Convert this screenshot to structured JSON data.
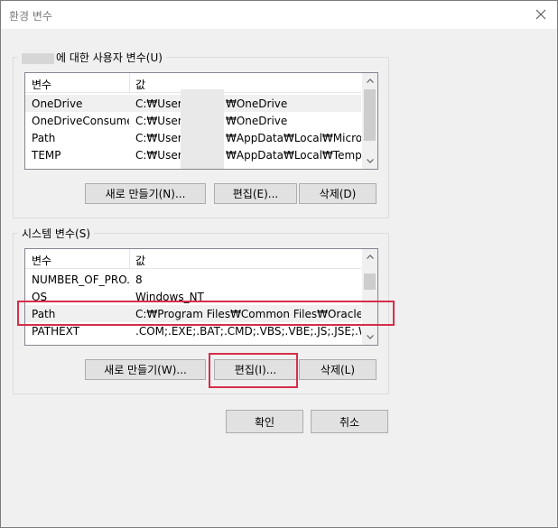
{
  "window": {
    "title": "환경 변수"
  },
  "user_vars": {
    "group_label": "에 대한 사용자 변수(U)",
    "col_name": "변수",
    "col_value": "값",
    "rows": [
      {
        "name": "OneDrive",
        "value_prefix": "C:₩Users",
        "value_suffix": "₩OneDrive"
      },
      {
        "name": "OneDriveConsumer",
        "value_prefix": "C:₩Users",
        "value_suffix": "₩OneDrive"
      },
      {
        "name": "Path",
        "value_prefix": "C:₩Users",
        "value_suffix": "₩AppData₩Local₩Micros..."
      },
      {
        "name": "TEMP",
        "value_prefix": "C:₩Users",
        "value_suffix": "₩AppData₩Local₩Temp"
      }
    ],
    "btn_new": "새로 만들기(N)...",
    "btn_edit": "편집(E)...",
    "btn_delete": "삭제(D)"
  },
  "system_vars": {
    "group_label": "시스템 변수(S)",
    "col_name": "변수",
    "col_value": "값",
    "rows": [
      {
        "name": "NUMBER_OF_PRO...",
        "value": "8"
      },
      {
        "name": "OS",
        "value": "Windows_NT"
      },
      {
        "name": "Path",
        "value": "C:₩Program Files₩Common Files₩Oracle₩..."
      },
      {
        "name": "PATHEXT",
        "value": ".COM;.EXE;.BAT;.CMD;.VBS;.VBE;.JS;.JSE;.W..."
      }
    ],
    "btn_new": "새로 만들기(W)...",
    "btn_edit": "편집(I)...",
    "btn_delete": "삭제(L)"
  },
  "footer": {
    "btn_ok": "확인",
    "btn_cancel": "취소"
  },
  "colors": {
    "highlight": "#d62e4a",
    "selected_row": "#f0f0f0"
  },
  "icons": {
    "close": "close-icon",
    "scroll_up": "chevron-up-icon",
    "scroll_down": "chevron-down-icon"
  }
}
